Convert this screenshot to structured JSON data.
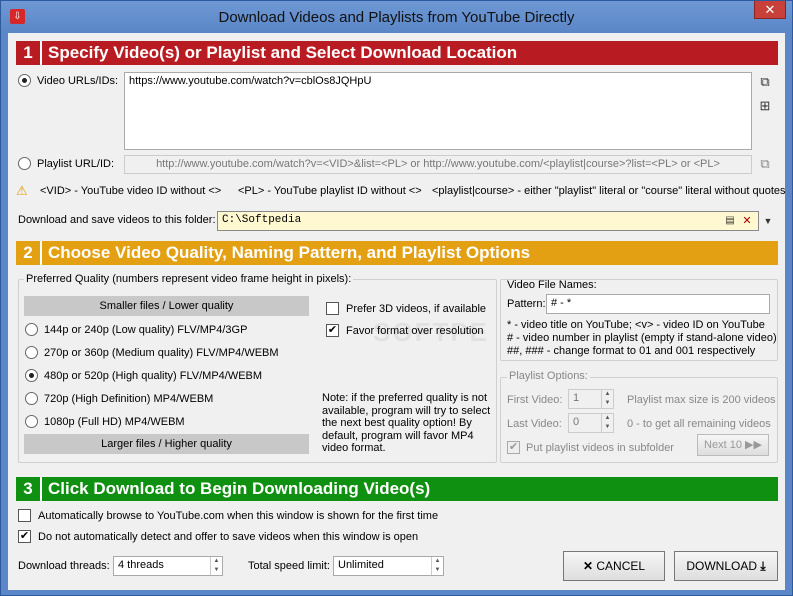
{
  "window": {
    "title": "Download Videos and Playlists from YouTube Directly",
    "close": "✕",
    "app_icon": "⇩"
  },
  "section1": {
    "num": "1",
    "title": "Specify Video(s) or Playlist and Select Download Location",
    "video_urls_label": "Video URLs/IDs:",
    "video_urls_value": "https://www.youtube.com/watch?v=cblOs8JQHpU",
    "playlist_label": "Playlist URL/ID:",
    "playlist_placeholder": "http://www.youtube.com/watch?v=<VID>&list=<PL>  or  http://www.youtube.com/<playlist|course>?list=<PL>  or  <PL>",
    "hint_vid": "<VID> - YouTube video ID without <>",
    "hint_pl": "<PL> - YouTube playlist ID without <>",
    "hint_course": "<playlist|course> - either \"playlist\" literal or \"course\" literal without quotes",
    "folder_label": "Download and save videos to this folder:",
    "folder_value": "C:\\Softpedia"
  },
  "section2": {
    "num": "2",
    "title": "Choose Video Quality, Naming Pattern, and Playlist Options",
    "quality_group_label": "Preferred Quality (numbers represent video frame height in pixels):",
    "smaller_label": "Smaller files / Lower quality",
    "larger_label": "Larger files / Higher quality",
    "qualities": [
      "144p or 240p (Low quality) FLV/MP4/3GP",
      "270p or 360p (Medium quality) FLV/MP4/WEBM",
      "480p or 520p (High quality) FLV/MP4/WEBM",
      "720p (High Definition) MP4/WEBM",
      "1080p (Full HD) MP4/WEBM"
    ],
    "prefer_3d": "Prefer 3D videos, if available",
    "favor_format": "Favor format over resolution",
    "note": "Note: if the preferred quality is not available, program will try to select the next best quality option! By default, program will favor MP4 video format.",
    "names_label": "Video File Names:",
    "pattern_label": "Pattern:",
    "pattern_value": "# - *",
    "pattern_help_1": "* - video title on YouTube; <v> - video ID on YouTube",
    "pattern_help_2": "# - video number in playlist (empty if stand-alone video)",
    "pattern_help_3": "##, ### - change format to 01 and 001 respectively",
    "playlist_options_label": "Playlist Options:",
    "first_video_label": "First Video:",
    "first_video_value": "1",
    "first_video_note": "Playlist max size is 200 videos",
    "last_video_label": "Last Video:",
    "last_video_value": "0",
    "last_video_note": "0 - to get all remaining videos",
    "subfolder_label": "Put playlist videos in subfolder",
    "next10_label": "Next 10"
  },
  "section3": {
    "num": "3",
    "title": "Click Download to Begin Downloading Video(s)",
    "auto_browse": "Automatically browse to YouTube.com when this window is shown for the first time",
    "no_auto_detect": "Do not automatically detect and offer to save videos when this window is open",
    "threads_label": "Download threads:",
    "threads_value": "4 threads",
    "speed_label": "Total speed limit:",
    "speed_value": "Unlimited",
    "cancel_label": "CANCEL",
    "download_label": "DOWNLOAD"
  }
}
